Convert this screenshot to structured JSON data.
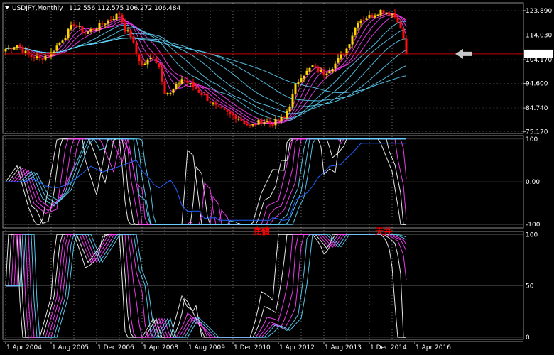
{
  "header": {
    "symbol": "USDJPY,Monthly",
    "open": "112.556",
    "high": "112.575",
    "low": "106.272",
    "close": "106.484"
  },
  "price_label": "106.484",
  "annotations": {
    "bottom": "底値",
    "top": "天井"
  },
  "colors": {
    "bull": "#ffd400",
    "bear": "#ff1010",
    "grid": "#ffffff",
    "ma_cyan": "#5fd7ff",
    "ma_magenta": "#ff40ff",
    "ma_white": "#ffffff",
    "ma_blue": "#2060ff",
    "price_line": "#c00000",
    "arrow": "#c8c8c8"
  },
  "chart_data": [
    {
      "type": "candlestick",
      "name": "price",
      "y_ticks": [
        "123.890",
        "114.030",
        "104.170",
        "94.600",
        "84.740",
        "75.170"
      ],
      "y_tick_values": [
        123.89,
        114.03,
        104.17,
        94.6,
        84.74,
        75.17
      ],
      "ylim": [
        74.5,
        127.0
      ],
      "x_labels": [
        "1 Apr 2004",
        "1 Aug 2005",
        "1 Dec 2006",
        "1 Apr 2008",
        "1 Aug 2009",
        "1 Dec 2010",
        "1 Apr 2012",
        "1 Aug 2013",
        "1 Dec 2014",
        "1 Apr 2016"
      ],
      "x_label_months": [
        0,
        16,
        32,
        48,
        64,
        80,
        96,
        112,
        128,
        144
      ],
      "current_price": 106.484,
      "close_path": [
        [
          0,
          108.5
        ],
        [
          4,
          110.2
        ],
        [
          8,
          105.8
        ],
        [
          12,
          104.6
        ],
        [
          16,
          106.8
        ],
        [
          20,
          112.5
        ],
        [
          24,
          118.6
        ],
        [
          28,
          114.8
        ],
        [
          32,
          117.2
        ],
        [
          36,
          119.8
        ],
        [
          40,
          122.6
        ],
        [
          42,
          116.4
        ],
        [
          44,
          113.8
        ],
        [
          46,
          106.5
        ],
        [
          48,
          101.8
        ],
        [
          52,
          105.6
        ],
        [
          54,
          101.2
        ],
        [
          56,
          91.5
        ],
        [
          58,
          90.4
        ],
        [
          62,
          96.5
        ],
        [
          66,
          93.2
        ],
        [
          70,
          89.5
        ],
        [
          74,
          85.2
        ],
        [
          78,
          82.6
        ],
        [
          82,
          80.8
        ],
        [
          86,
          77.2
        ],
        [
          90,
          79.6
        ],
        [
          94,
          78.5
        ],
        [
          98,
          80.8
        ],
        [
          100,
          86.2
        ],
        [
          102,
          93.5
        ],
        [
          104,
          97.8
        ],
        [
          106,
          99.2
        ],
        [
          108,
          101.5
        ],
        [
          112,
          98.6
        ],
        [
          116,
          102.5
        ],
        [
          120,
          108.6
        ],
        [
          124,
          119.8
        ],
        [
          128,
          121.5
        ],
        [
          132,
          123.9
        ],
        [
          136,
          122.6
        ],
        [
          138,
          120.2
        ],
        [
          140,
          112.6
        ],
        [
          141,
          106.5
        ]
      ]
    },
    {
      "type": "line",
      "name": "oscillator-1",
      "y_ticks": [
        "100",
        "0.00",
        "-100"
      ],
      "y_tick_values": [
        100,
        0,
        -100
      ],
      "ylim": [
        -108,
        108
      ]
    },
    {
      "type": "line",
      "name": "oscillator-2",
      "y_ticks": [
        "100",
        "50",
        "0"
      ],
      "y_tick_values": [
        100,
        50,
        0
      ],
      "ylim": [
        -2,
        103
      ]
    }
  ]
}
